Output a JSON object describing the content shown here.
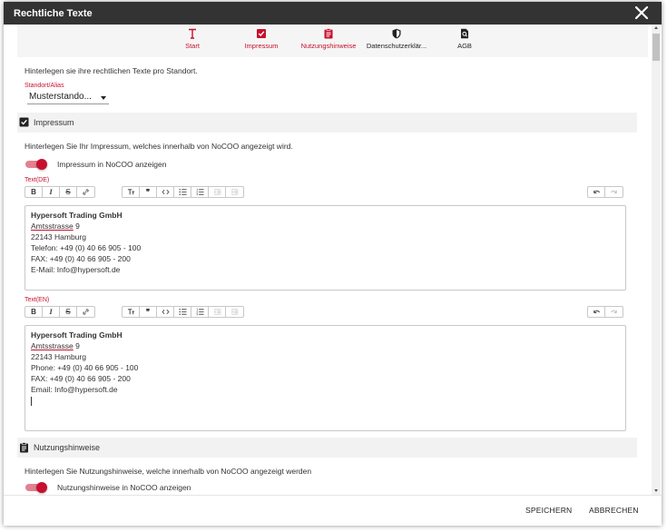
{
  "window": {
    "title": "Rechtliche Texte"
  },
  "tabs": [
    {
      "label": "Start",
      "icon": "text-cursor-icon",
      "state": "red"
    },
    {
      "label": "Impressum",
      "icon": "checkbox-icon",
      "state": "red"
    },
    {
      "label": "Nutzungshinweise",
      "icon": "clipboard-icon",
      "state": "red"
    },
    {
      "label": "Datenschutzerklär...",
      "icon": "shield-icon",
      "state": "dark"
    },
    {
      "label": "AGB",
      "icon": "doc-search-icon",
      "state": "dark"
    }
  ],
  "intro": "Hinterlegen sie ihre rechtlichen Texte pro Standort.",
  "location": {
    "label": "Standort/Alias",
    "value": "Musterstando..."
  },
  "impressum": {
    "title": "Impressum",
    "description": "Hinterlegen Sie Ihr Impressum, welches innerhalb von NoCOO angezeigt wird.",
    "toggle_label": "Impressum in NoCOO anzeigen",
    "de": {
      "label": "Text(DE)",
      "lines": [
        "Hypersoft Trading GmbH",
        "Amtsstrasse",
        "9",
        "22143 Hamburg",
        "Telefon: +49 (0) 40 66 905 - 100",
        "FAX: +49 (0) 40 66 905 - 200",
        "E-Mail: Info@hypersoft.de"
      ]
    },
    "en": {
      "label": "Text(EN)",
      "lines": [
        "Hypersoft Trading GmbH",
        "Amtsstrasse",
        "9",
        "22143 Hamburg",
        "Phone: +49 (0) 40 66 905 - 100",
        "FAX: +49 (0) 40 66 905 - 200",
        "Email: Info@hypersoft.de"
      ]
    }
  },
  "nutzung": {
    "title": "Nutzungshinweise",
    "description": "Hinterlegen Sie Nutzungshinweise, welche innerhalb von NoCOO angezeigt werden",
    "toggle_label": "Nutzungshinweise in NoCOO anzeigen"
  },
  "footer": {
    "save": "SPEICHERN",
    "cancel": "ABBRECHEN"
  },
  "colors": {
    "accent": "#c8102e",
    "titlebar": "#333333",
    "section_bg": "#f2f2f2"
  }
}
